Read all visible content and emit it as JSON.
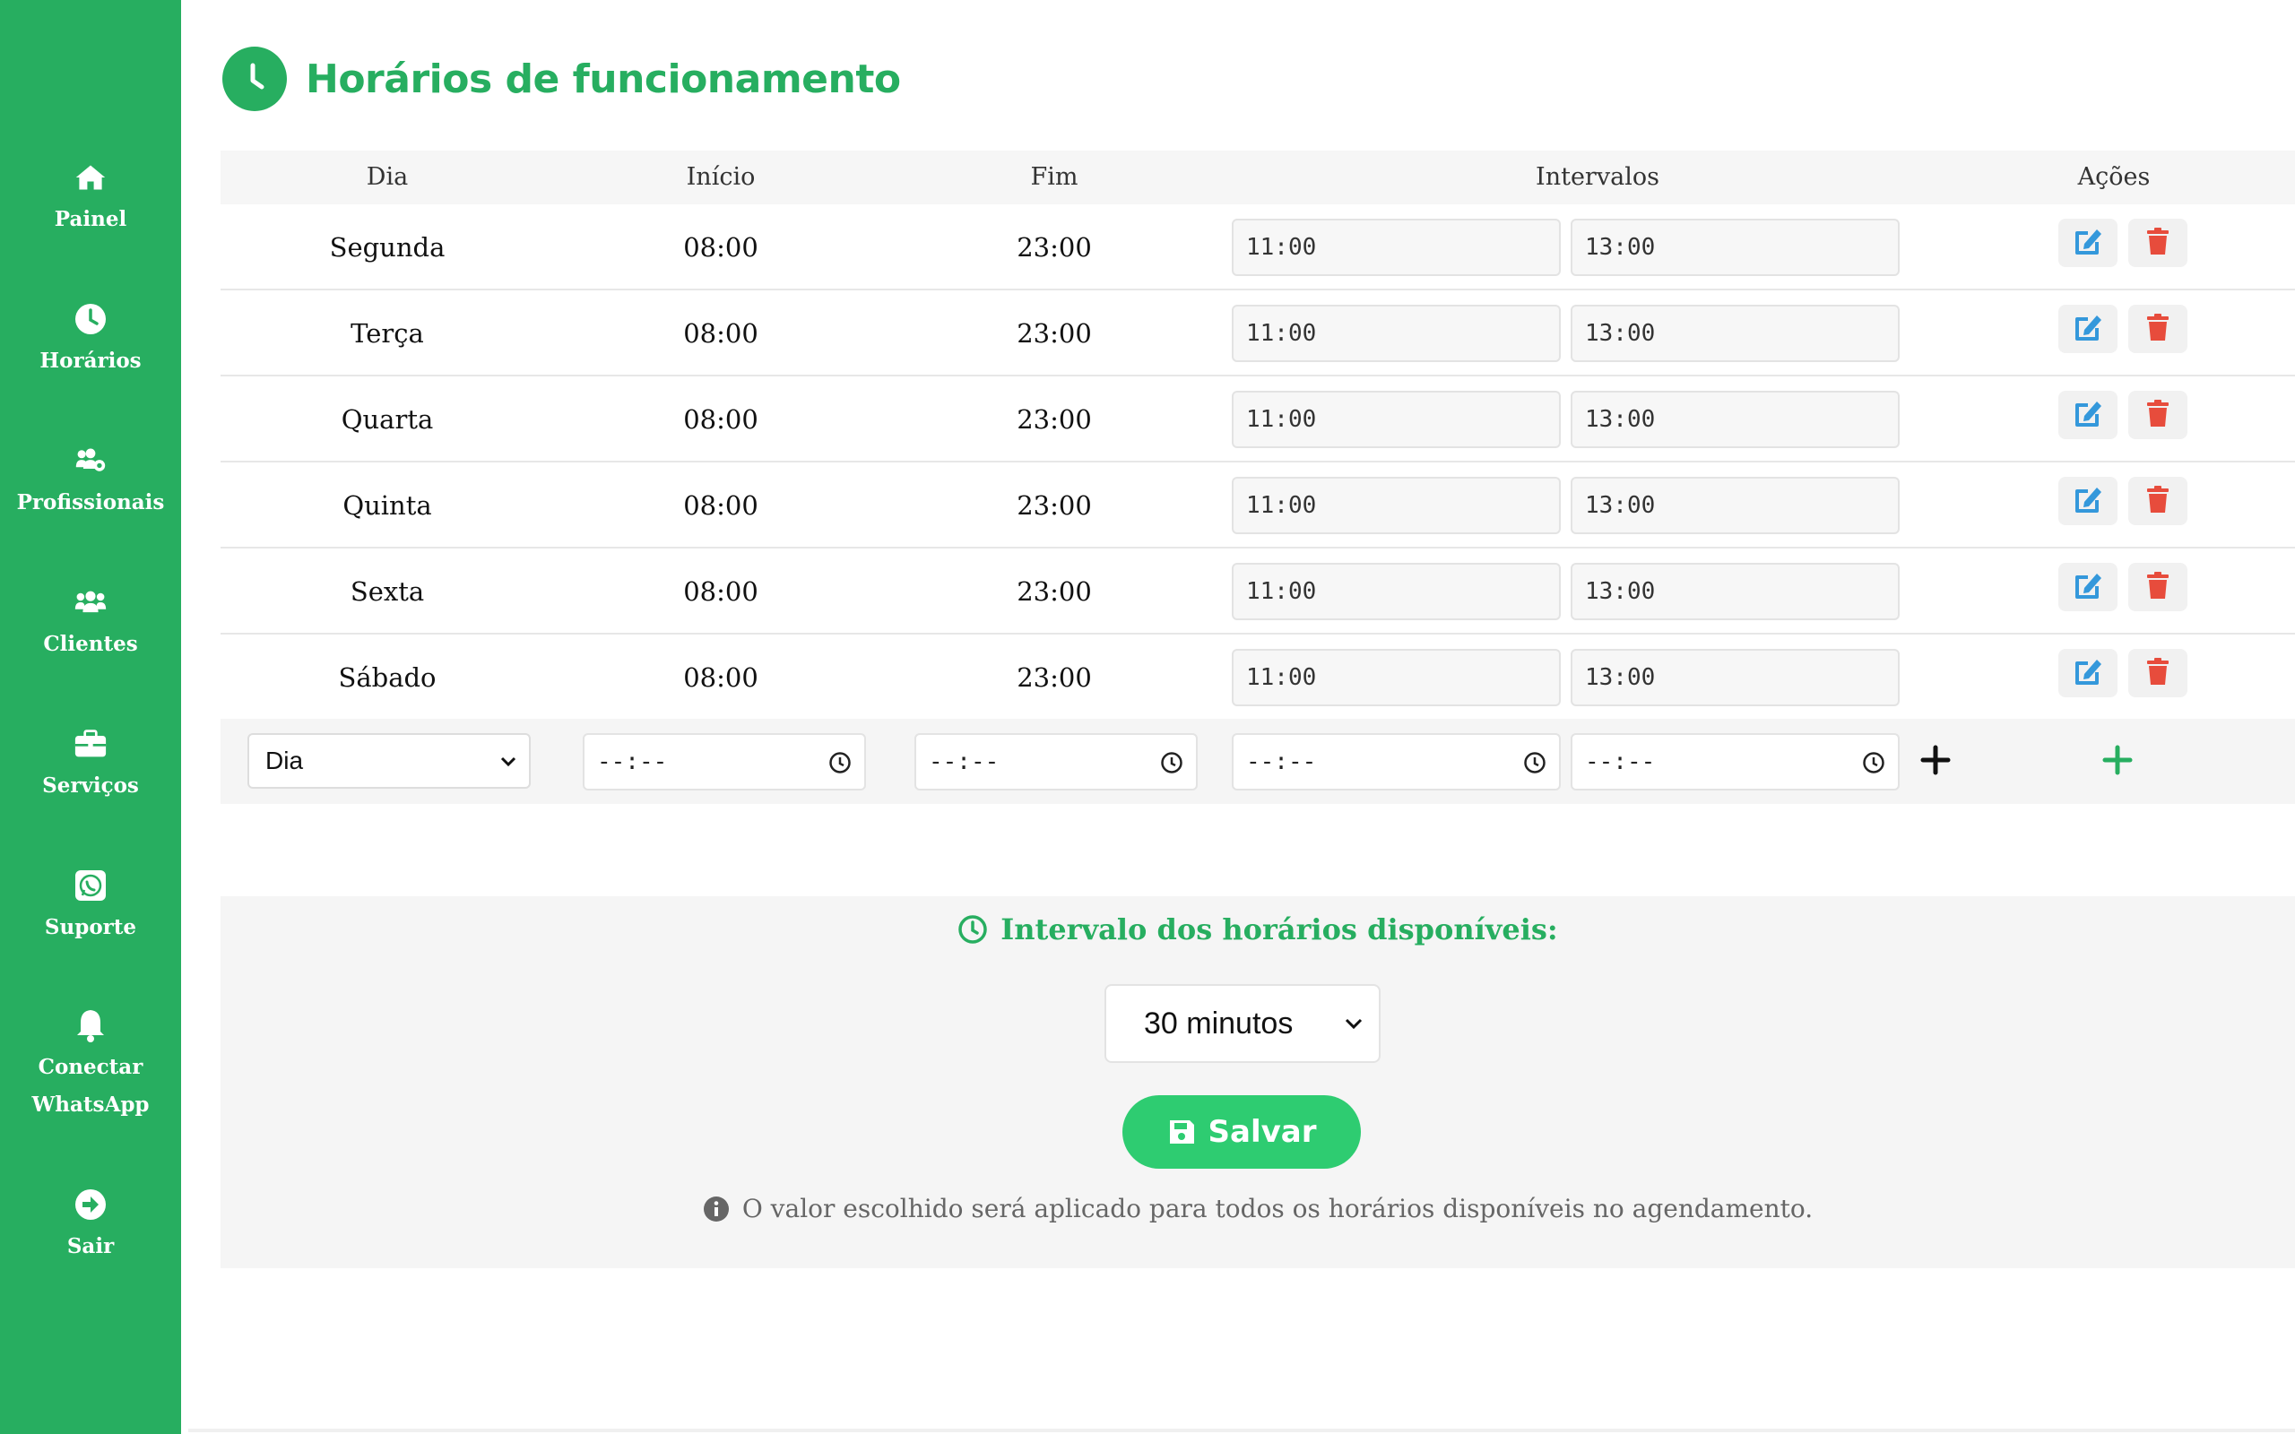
{
  "sidebar": {
    "items": [
      {
        "label": "Painel",
        "icon": "home-icon"
      },
      {
        "label": "Horários",
        "icon": "clock-icon"
      },
      {
        "label": "Profissionais",
        "icon": "users-cog-icon"
      },
      {
        "label": "Clientes",
        "icon": "users-icon"
      },
      {
        "label": "Serviços",
        "icon": "briefcase-icon"
      },
      {
        "label": "Suporte",
        "icon": "whatsapp-icon"
      },
      {
        "label": "Conectar\nWhatsApp",
        "icon": "bell-icon"
      },
      {
        "label": "Sair",
        "icon": "sign-out-icon"
      }
    ]
  },
  "header": {
    "title": "Horários de funcionamento"
  },
  "table": {
    "columns": [
      "Dia",
      "Início",
      "Fim",
      "Intervalos",
      "Ações"
    ],
    "rows": [
      {
        "dia": "Segunda",
        "inicio": "08:00",
        "fim": "23:00",
        "int_start": "11:00",
        "int_end": "13:00"
      },
      {
        "dia": "Terça",
        "inicio": "08:00",
        "fim": "23:00",
        "int_start": "11:00",
        "int_end": "13:00"
      },
      {
        "dia": "Quarta",
        "inicio": "08:00",
        "fim": "23:00",
        "int_start": "11:00",
        "int_end": "13:00"
      },
      {
        "dia": "Quinta",
        "inicio": "08:00",
        "fim": "23:00",
        "int_start": "11:00",
        "int_end": "13:00"
      },
      {
        "dia": "Sexta",
        "inicio": "08:00",
        "fim": "23:00",
        "int_start": "11:00",
        "int_end": "13:00"
      },
      {
        "dia": "Sábado",
        "inicio": "08:00",
        "fim": "23:00",
        "int_start": "11:00",
        "int_end": "13:00"
      }
    ],
    "new_row": {
      "day_select": "Dia",
      "time_placeholder": "--:--"
    }
  },
  "interval": {
    "title": "Intervalo dos horários disponíveis:",
    "selected": "30 minutos",
    "save_label": "Salvar",
    "note": "O valor escolhido será aplicado para todos os horários disponíveis no agendamento."
  },
  "colors": {
    "brand": "#27ae60",
    "save": "#2ecc71",
    "edit": "#3498db",
    "delete": "#e74c3c"
  }
}
